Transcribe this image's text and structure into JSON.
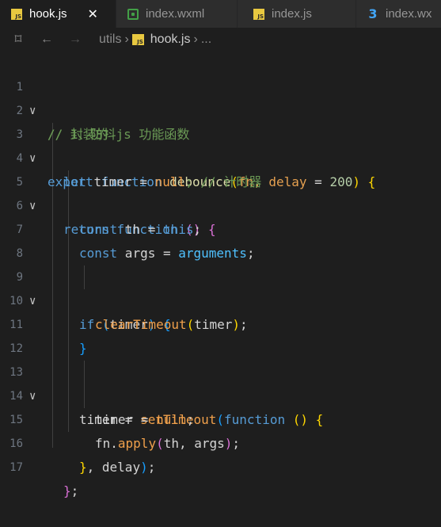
{
  "tabs": [
    {
      "icon": "js-file-icon",
      "label": "hook.js",
      "active": true
    },
    {
      "icon": "wxml-file-icon",
      "label": "index.wxml",
      "active": false
    },
    {
      "icon": "js-file-icon",
      "label": "index.js",
      "active": false
    },
    {
      "icon": "css-file-icon",
      "label": "index.wx",
      "active": false
    }
  ],
  "breadcrumb": {
    "folder": "utils",
    "file": "hook.js",
    "trail": "..."
  },
  "code": {
    "line_numbers": [
      "1",
      "2",
      "3",
      "4",
      "5",
      "6",
      "7",
      "8",
      "9",
      "10",
      "11",
      "12",
      "13",
      "14",
      "15",
      "16",
      "17"
    ],
    "l1": "// 封装的 js 功能函数",
    "l2": "// 1、防抖",
    "l3": {
      "export": "export",
      "function": "function",
      "name": "debounce",
      "open": "(",
      "args": "fn, delay",
      "eq": " = ",
      "num": "200",
      "close": ")",
      "brace": "{"
    },
    "l4": {
      "let": "let",
      "rest": " timer = ",
      "null": "null",
      "comment": "; // 计时器"
    },
    "l5": {
      "return": "return",
      "function": "function",
      "parens": "()",
      "brace": "{"
    },
    "l6": {
      "const": "const",
      "rest": " th = ",
      "this": "this",
      "end": ";"
    },
    "l7": {
      "const": "const",
      "rest": " args = ",
      "arguments": "arguments",
      "end": ";"
    },
    "l9": {
      "if": "if",
      "open": "(",
      "cond": "timer",
      "close": ")",
      "brace": "{"
    },
    "l10": {
      "call": "clearTimeout",
      "open": "(",
      "arg": "timer",
      "close": ")",
      "end": ";"
    },
    "l11": "}",
    "l13": {
      "lhs": "timer = ",
      "call": "setTimeout",
      "open": "(",
      "function": "function",
      "parens": "()",
      "brace": "{"
    },
    "l14": {
      "lhs": "timer = ",
      "null": "null",
      "end": ";"
    },
    "l15": {
      "obj": "fn.",
      "call": "apply",
      "open": "(",
      "args": "th, args",
      "close": ")",
      "end": ";"
    },
    "l16": {
      "brace": "}",
      "rest": ", delay",
      "close": ")",
      "end": ";"
    },
    "l17": {
      "brace": "}",
      "end": ";"
    }
  }
}
